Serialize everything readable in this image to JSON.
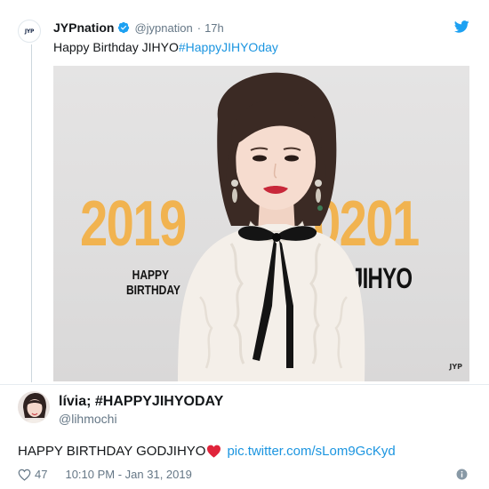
{
  "quoted": {
    "name": "JYPnation",
    "handle": "@jypnation",
    "dot": "·",
    "time": "17h",
    "text": "Happy Birthday JIHYO",
    "hashtag": "#HappyJIHYOday",
    "avatar_icon": "jyp-logo-icon",
    "verified_icon": "verified-badge-icon",
    "platform_icon": "twitter-bird-icon"
  },
  "media": {
    "number_left": "2019",
    "number_right": "0201",
    "happy_line1": "HAPPY",
    "happy_line2": "BIRTHDAY",
    "name": "JIHYO",
    "accent_color": "#f1b350"
  },
  "main": {
    "name": "lívia; #HAPPYJIHYODAY",
    "handle": "@lihmochi",
    "text": "HAPPY BIRTHDAY GODJIHYO",
    "emoji_icon": "red-heart-icon",
    "link": "pic.twitter.com/sLom9GcKyd",
    "likes": "47",
    "timestamp": "10:10 PM - Jan 31, 2019",
    "like_icon": "heart-outline-icon",
    "info_icon": "info-icon"
  },
  "colors": {
    "link": "#1b95e0",
    "secondary_text": "#657786",
    "primary_text": "#14171a"
  }
}
